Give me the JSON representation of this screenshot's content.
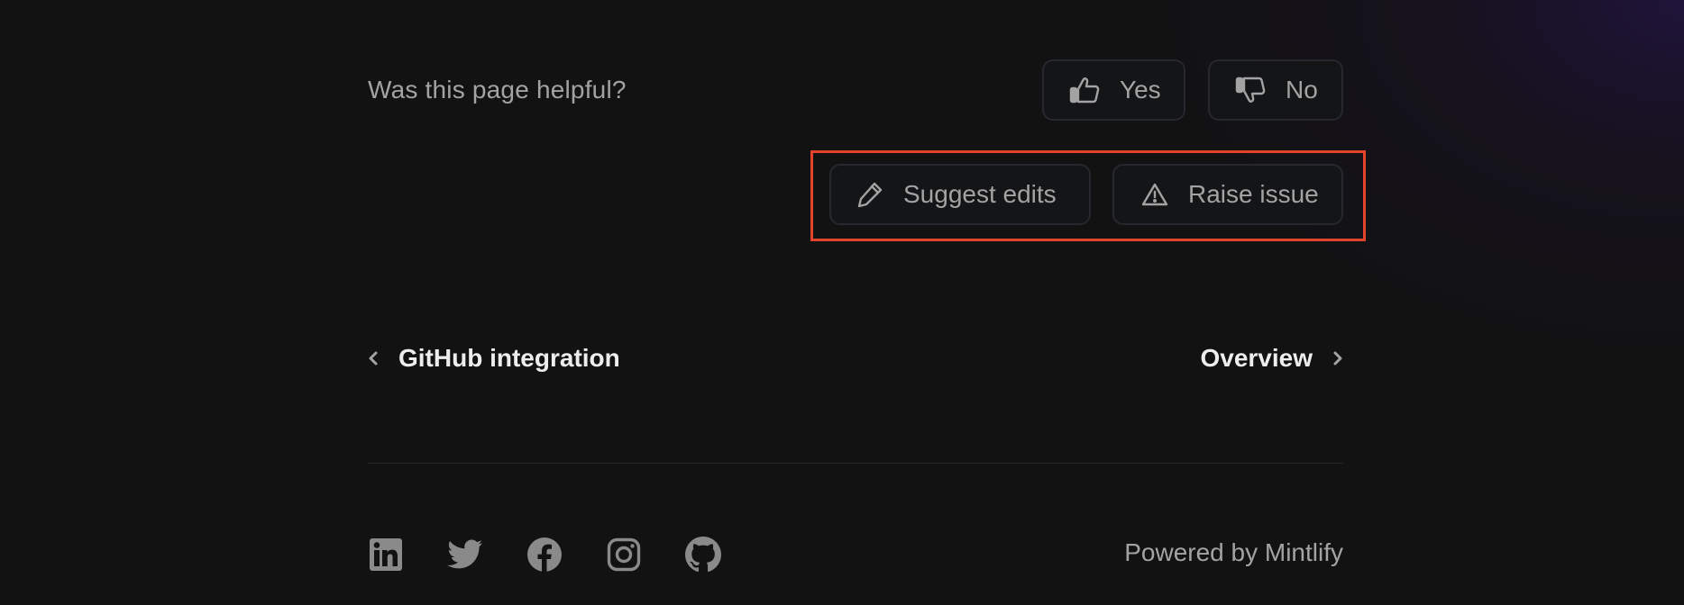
{
  "feedback": {
    "question": "Was this page helpful?",
    "yes_label": "Yes",
    "no_label": "No",
    "yes_icon": "thumbs-up-icon",
    "no_icon": "thumbs-down-icon"
  },
  "contribute": {
    "suggest_label": "Suggest edits",
    "raise_label": "Raise issue",
    "suggest_icon": "pencil-icon",
    "raise_icon": "warning-triangle-icon",
    "highlight_color": "#e3432a"
  },
  "pagination": {
    "prev_label": "GitHub integration",
    "next_label": "Overview"
  },
  "footer": {
    "socials": [
      "linkedin",
      "twitter",
      "facebook",
      "instagram",
      "github"
    ],
    "powered_by": "Powered by Mintlify"
  },
  "colors": {
    "background": "#121212",
    "muted_text": "#a3a3a3",
    "strong_text": "#ededed",
    "button_border": "#26282d",
    "icon_gray": "#8a8a8a"
  }
}
